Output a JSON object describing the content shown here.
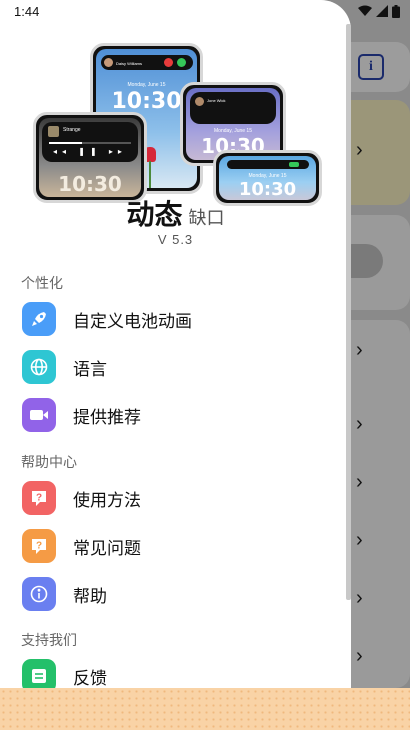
{
  "status_bar": {
    "time": "1:44"
  },
  "app": {
    "name": "动态",
    "subtitle": "缺口",
    "version": "V 5.3"
  },
  "hero": {
    "phone_time": "10:30",
    "phone_time_small": "10:30",
    "phone_date": "Monday, June 15",
    "caller_name": "Daisy Williams",
    "song_title": "Strange",
    "message_sender": "Jone Wick"
  },
  "sections": [
    {
      "title": "个性化",
      "items": [
        {
          "label": "自定义电池动画",
          "color": "#4a9df8",
          "icon": "rocket-icon"
        },
        {
          "label": "语言",
          "color": "#2ec6d3",
          "icon": "globe-icon"
        },
        {
          "label": "提供推荐",
          "color": "#9163e8",
          "icon": "video-icon"
        }
      ]
    },
    {
      "title": "帮助中心",
      "items": [
        {
          "label": "使用方法",
          "color": "#f26464",
          "icon": "question-chat-icon"
        },
        {
          "label": "常见问题",
          "color": "#f59b45",
          "icon": "question-chat-icon"
        },
        {
          "label": "帮助",
          "color": "#6a7ff0",
          "icon": "info-icon"
        }
      ]
    },
    {
      "title": "支持我们",
      "items": [
        {
          "label": "反馈",
          "color": "#24c06a",
          "icon": "feedback-icon"
        }
      ]
    }
  ]
}
